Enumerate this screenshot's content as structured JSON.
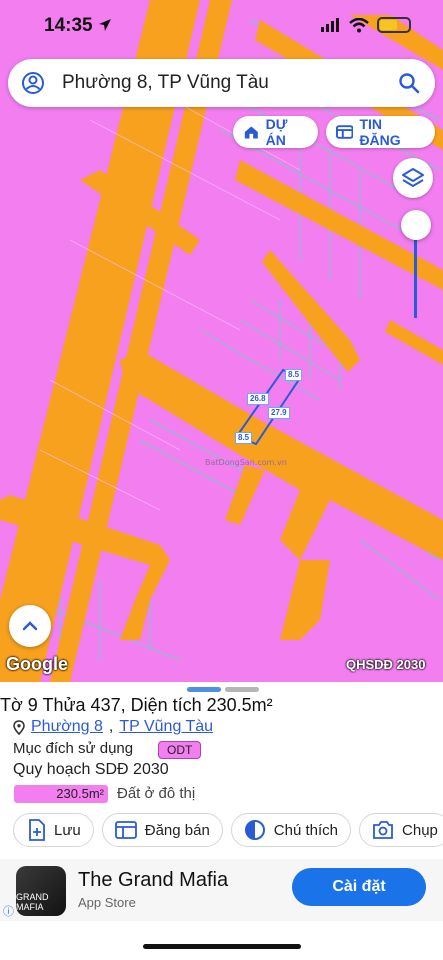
{
  "status": {
    "time": "14:35"
  },
  "search": {
    "query": "Phường 8, TP Vũng Tàu"
  },
  "map_buttons": {
    "du_an": "DỰ ÁN",
    "tin_dang": "TIN ĐĂNG"
  },
  "map": {
    "attribution": "Google",
    "layer_label": "QHSDĐ 2030",
    "dims": {
      "top": "8.5",
      "left": "26.8",
      "right": "27.9",
      "bottom": "8.5"
    }
  },
  "parcel": {
    "title": "Tờ 9 Thửa 437, Diện tích 230.5m²",
    "ward": "Phường 8",
    "city": "TP Vũng Tàu",
    "purpose_label": "Mục đích sử dụng",
    "purpose_code": "ODT",
    "plan_label": "Quy hoạch SDĐ 2030",
    "plan_area": "230.5m²",
    "plan_type": "Đất ở đô thị"
  },
  "actions": [
    "Lưu",
    "Đăng bán",
    "Chú thích",
    "Chụp"
  ],
  "ad": {
    "name": "The Grand Mafia",
    "store": "App Store",
    "cta": "Cài đặt",
    "logo_text": "GRAND MAFIA"
  },
  "colors": {
    "land": "#f27ef0",
    "road": "#f7a11e",
    "accent": "#2a5bd7"
  }
}
